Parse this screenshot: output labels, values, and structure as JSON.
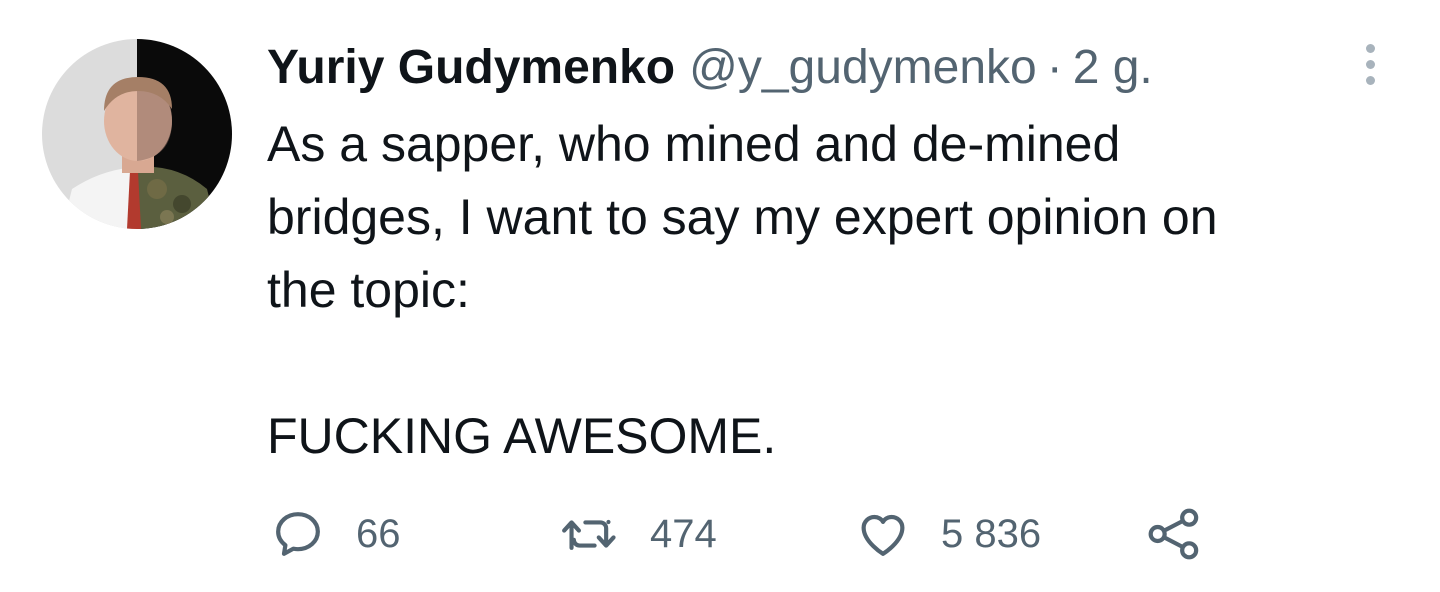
{
  "tweet": {
    "author": {
      "name": "Yuriy Gudymenko",
      "handle": "@y_gudymenko",
      "separator": "·",
      "time": "2 g."
    },
    "text": {
      "line1": "As a sapper, who mined and de-mined",
      "line2": "bridges, I want to say my expert opinion on",
      "line3": "the topic:",
      "line4": "FUCKING AWESOME."
    },
    "actions": {
      "replies": "66",
      "retweets": "474",
      "likes": "5 836"
    },
    "icons": {
      "more": "more-vertical-icon",
      "reply": "reply-icon",
      "retweet": "retweet-icon",
      "like": "heart-icon",
      "share": "share-icon"
    },
    "colors": {
      "text": "#0f1419",
      "secondary": "#536471",
      "icon": "#536471"
    }
  }
}
